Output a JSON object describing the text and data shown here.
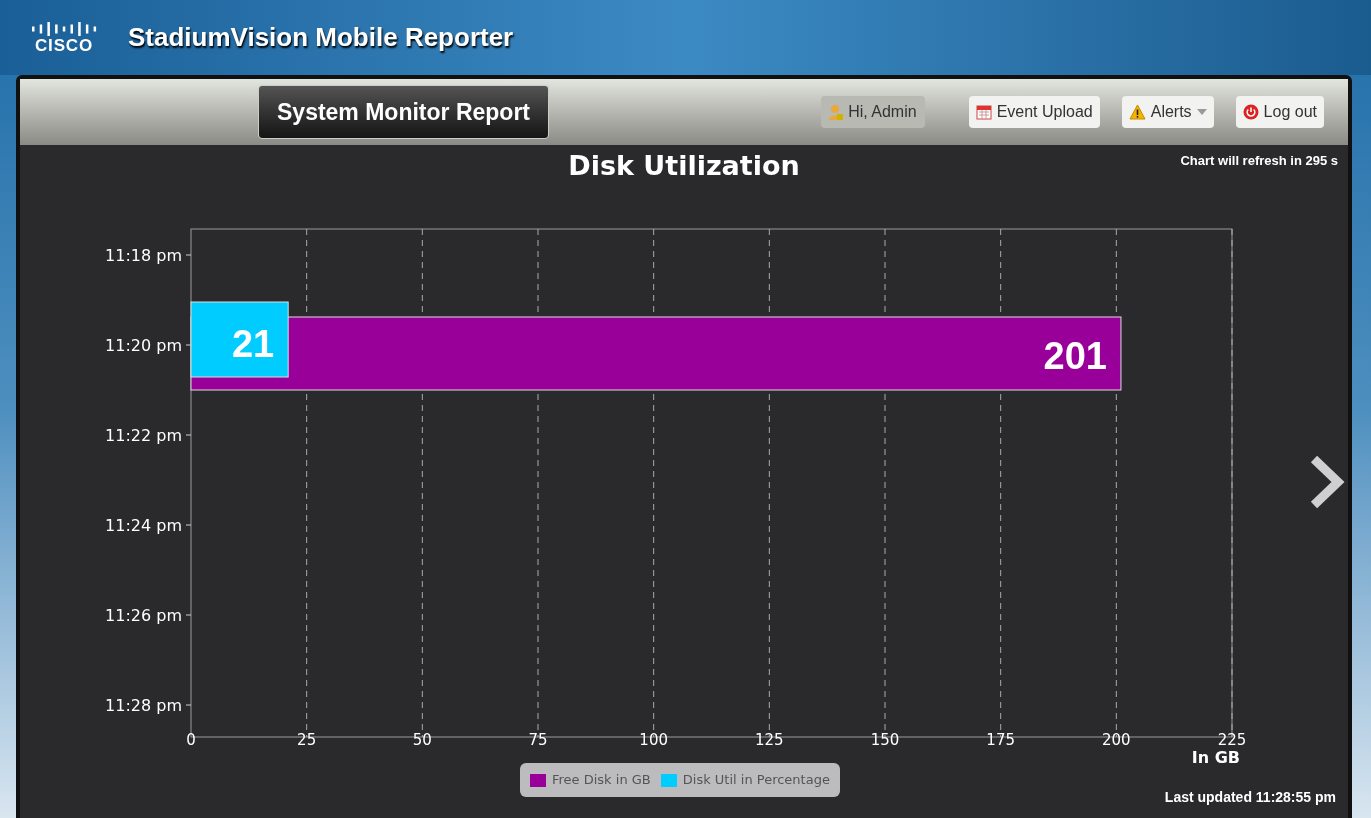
{
  "header": {
    "logo": "CISCO",
    "title": "StadiumVision Mobile Reporter"
  },
  "toolbar": {
    "report_title": "System Monitor Report",
    "user": "Hi, Admin",
    "buttons": [
      {
        "kind": "upload",
        "label": "Event Upload"
      },
      {
        "kind": "alerts",
        "label": "Alerts"
      },
      {
        "kind": "logout",
        "label": "Log out"
      }
    ]
  },
  "refresh_note": "Chart will refresh in 295 s",
  "chart": {
    "chart_data": {
      "type": "bar",
      "orientation": "horizontal",
      "title": "Disk Utilization",
      "xlabel": "In GB",
      "categories": [
        "11:18 pm",
        "11:20 pm",
        "11:22 pm",
        "11:24 pm",
        "11:26 pm",
        "11:28 pm"
      ],
      "series": [
        {
          "name": "Free Disk in GB",
          "color": "#990099",
          "values": [
            null,
            201,
            null,
            null,
            null,
            null
          ]
        },
        {
          "name": "Disk Util in Percentage",
          "color": "#00ccff",
          "values": [
            null,
            21,
            null,
            null,
            null,
            null
          ]
        }
      ],
      "xlim": [
        0,
        225
      ],
      "grid": true,
      "xticks": [
        0,
        25,
        50,
        75,
        100,
        125,
        150,
        175,
        200,
        225
      ],
      "data_labels": true
    }
  },
  "last_updated": "Last updated 11:28:55 pm"
}
